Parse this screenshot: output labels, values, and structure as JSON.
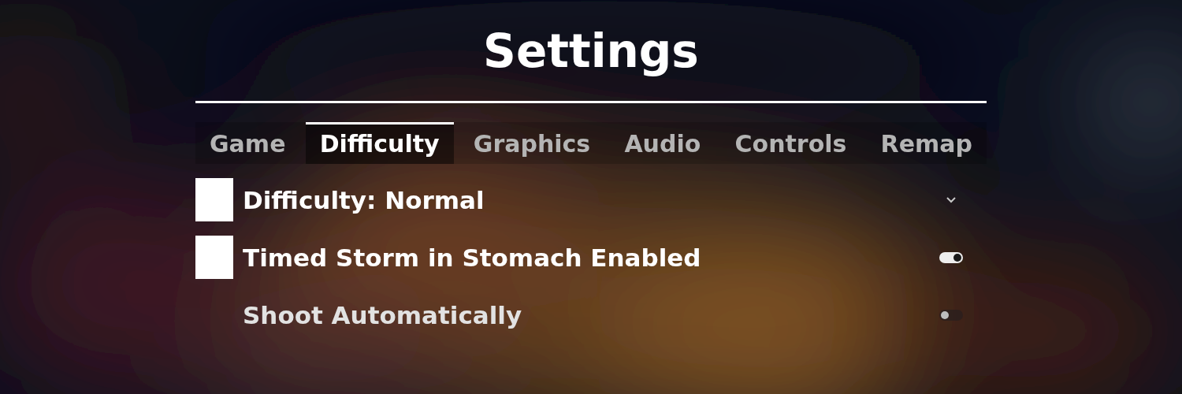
{
  "title": "Settings",
  "tabs": [
    {
      "label": "Game",
      "selected": false
    },
    {
      "label": "Difficulty",
      "selected": true
    },
    {
      "label": "Graphics",
      "selected": false
    },
    {
      "label": "Audio",
      "selected": false
    },
    {
      "label": "Controls",
      "selected": false
    },
    {
      "label": "Remap",
      "selected": false
    }
  ],
  "rows": [
    {
      "kind": "dropdown",
      "label": "Difficulty: Normal",
      "highlighted": true
    },
    {
      "kind": "toggle",
      "label": "Timed Storm in Stomach Enabled",
      "highlighted": true,
      "on": true
    },
    {
      "kind": "toggle",
      "label": "Shoot Automatically",
      "highlighted": false,
      "on": false
    }
  ]
}
